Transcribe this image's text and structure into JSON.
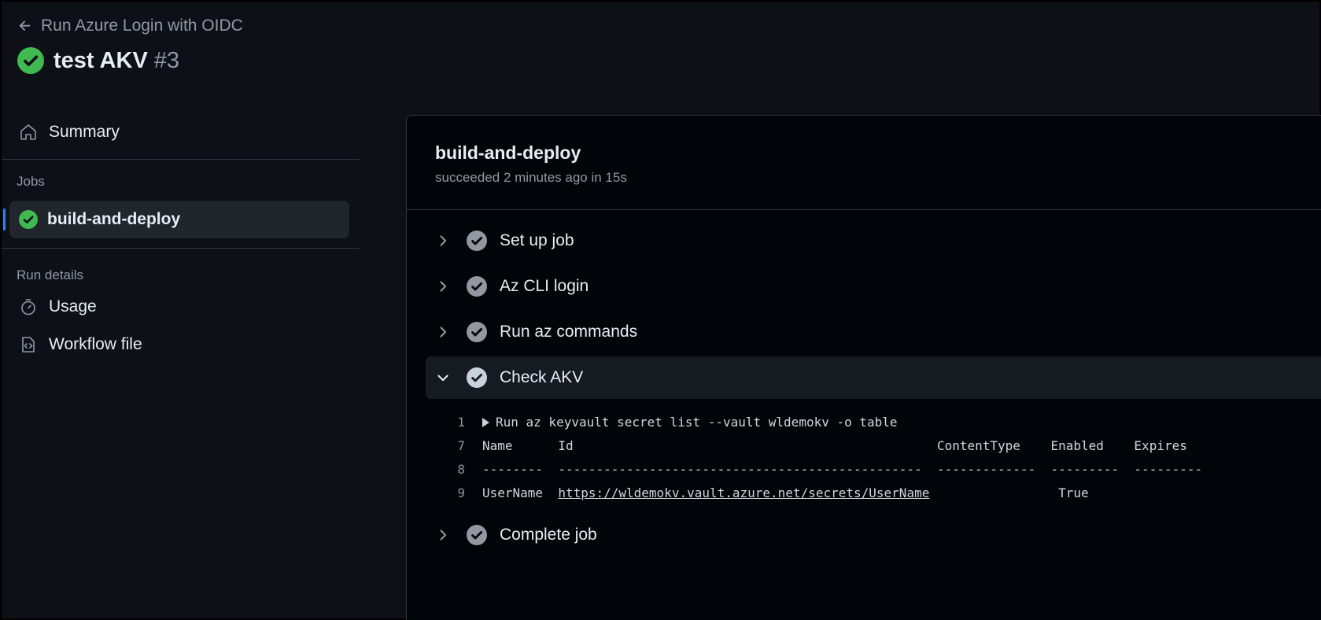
{
  "header": {
    "back_label": "Run Azure Login with OIDC",
    "title": "test AKV",
    "run_number": "#3"
  },
  "sidebar": {
    "summary_label": "Summary",
    "jobs_heading": "Jobs",
    "job_label": "build-and-deploy",
    "run_details_heading": "Run details",
    "usage_label": "Usage",
    "workflow_label": "Workflow file"
  },
  "job": {
    "title": "build-and-deploy",
    "meta": "succeeded 2 minutes ago in 15s"
  },
  "steps": [
    {
      "label": "Set up job",
      "expanded": false
    },
    {
      "label": "Az CLI login",
      "expanded": false
    },
    {
      "label": "Run az commands",
      "expanded": false
    },
    {
      "label": "Check AKV",
      "expanded": true
    },
    {
      "label": "Complete job",
      "expanded": false
    }
  ],
  "log": {
    "line1_no": "1",
    "line1_text": "Run az keyvault secret list --vault wldemokv -o table",
    "line7_no": "7",
    "line7_text": "Name      Id                                                ContentType    Enabled    Expires",
    "line8_no": "8",
    "line8_text": "--------  ------------------------------------------------  -------------  ---------  ---------",
    "line9_no": "9",
    "line9_name": "UserName  ",
    "line9_link": "https://wldemokv.vault.azure.net/secrets/UserName",
    "line9_rest": "                 True"
  },
  "colors": {
    "success": "#3fb950",
    "step_check": "#9198a1",
    "accent": "#2f81f7"
  }
}
